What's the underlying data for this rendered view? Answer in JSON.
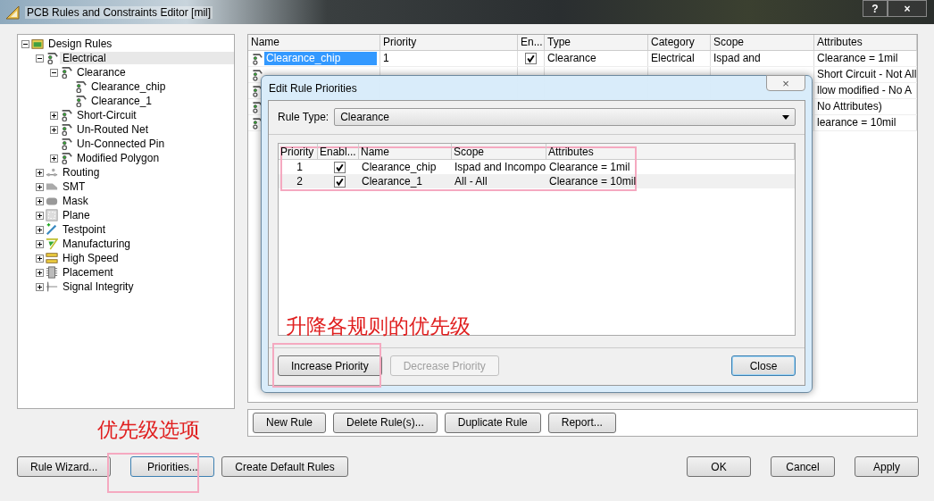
{
  "window": {
    "title": "PCB Rules and Constraints Editor [mil]",
    "help": "?",
    "close": "×"
  },
  "tree": [
    {
      "label": "Design Rules",
      "kind": "root",
      "expanded": true,
      "selected": false,
      "children": [
        {
          "label": "Electrical",
          "kind": "rule",
          "expanded": true,
          "selected": true,
          "children": [
            {
              "label": "Clearance",
              "kind": "rule",
              "expanded": true,
              "selected": false,
              "children": [
                {
                  "label": "Clearance_chip",
                  "kind": "rule",
                  "selected": false
                },
                {
                  "label": "Clearance_1",
                  "kind": "rule",
                  "selected": false
                }
              ]
            },
            {
              "label": "Short-Circuit",
              "kind": "rule",
              "expanded": false,
              "selected": false
            },
            {
              "label": "Un-Routed Net",
              "kind": "rule",
              "expanded": false,
              "selected": false
            },
            {
              "label": "Un-Connected Pin",
              "kind": "rule",
              "selected": false
            },
            {
              "label": "Modified Polygon",
              "kind": "rule",
              "expanded": false,
              "selected": false
            }
          ]
        },
        {
          "label": "Routing",
          "kind": "routing",
          "expanded": false,
          "selected": false
        },
        {
          "label": "SMT",
          "kind": "smt",
          "expanded": false,
          "selected": false
        },
        {
          "label": "Mask",
          "kind": "mask",
          "expanded": false,
          "selected": false
        },
        {
          "label": "Plane",
          "kind": "plane",
          "expanded": false,
          "selected": false
        },
        {
          "label": "Testpoint",
          "kind": "testpoint",
          "expanded": false,
          "selected": false
        },
        {
          "label": "Manufacturing",
          "kind": "manufacturing",
          "expanded": false,
          "selected": false
        },
        {
          "label": "High Speed",
          "kind": "highspeed",
          "expanded": false,
          "selected": false
        },
        {
          "label": "Placement",
          "kind": "placement",
          "expanded": false,
          "selected": false
        },
        {
          "label": "Signal Integrity",
          "kind": "signal",
          "expanded": false,
          "selected": false
        }
      ]
    }
  ],
  "table": {
    "columns": [
      "Name",
      "Priority",
      "En...",
      "Type",
      "Category",
      "Scope",
      "Attributes"
    ],
    "rows": [
      {
        "selected": true,
        "name": "Clearance_chip",
        "priority": "1",
        "enabled": true,
        "type": "Clearance",
        "category": "Electrical",
        "scope": "Ispad and",
        "attributes": "Clearance = 1mil"
      },
      {
        "attributes": "Short Circuit - Not All"
      },
      {
        "attributes": "llow modified - No  A"
      },
      {
        "attributes": "No Attributes)"
      },
      {
        "attributes": "learance = 10mil"
      }
    ]
  },
  "rule_buttons": [
    "New Rule",
    "Delete Rule(s)...",
    "Duplicate Rule",
    "Report..."
  ],
  "footer_left": [
    "Rule Wizard...",
    "Priorities...",
    "Create Default Rules"
  ],
  "footer_right": [
    "OK",
    "Cancel",
    "Apply"
  ],
  "dialog": {
    "title": "Edit Rule Priorities",
    "close": "×",
    "rule_type_label": "Rule Type:",
    "rule_type": "Clearance",
    "columns": [
      "Priority",
      "Enabl...",
      "Name",
      "Scope",
      "Attributes"
    ],
    "rows": [
      {
        "priority": "1",
        "enabled": true,
        "name": "Clearance_chip",
        "scope": "Ispad and Incompo",
        "attributes": "Clearance = 1mil"
      },
      {
        "priority": "2",
        "enabled": true,
        "name": "Clearance_1",
        "scope": "All    -    All",
        "attributes": "Clearance = 10mil"
      }
    ],
    "buttons": [
      {
        "label": "Increase Priority",
        "disabled": false
      },
      {
        "label": "Decrease Priority",
        "disabled": true
      }
    ],
    "close_button": "Close"
  },
  "annotations": [
    {
      "text": "升降各规则的优先级"
    },
    {
      "text": "优先级选项"
    }
  ]
}
